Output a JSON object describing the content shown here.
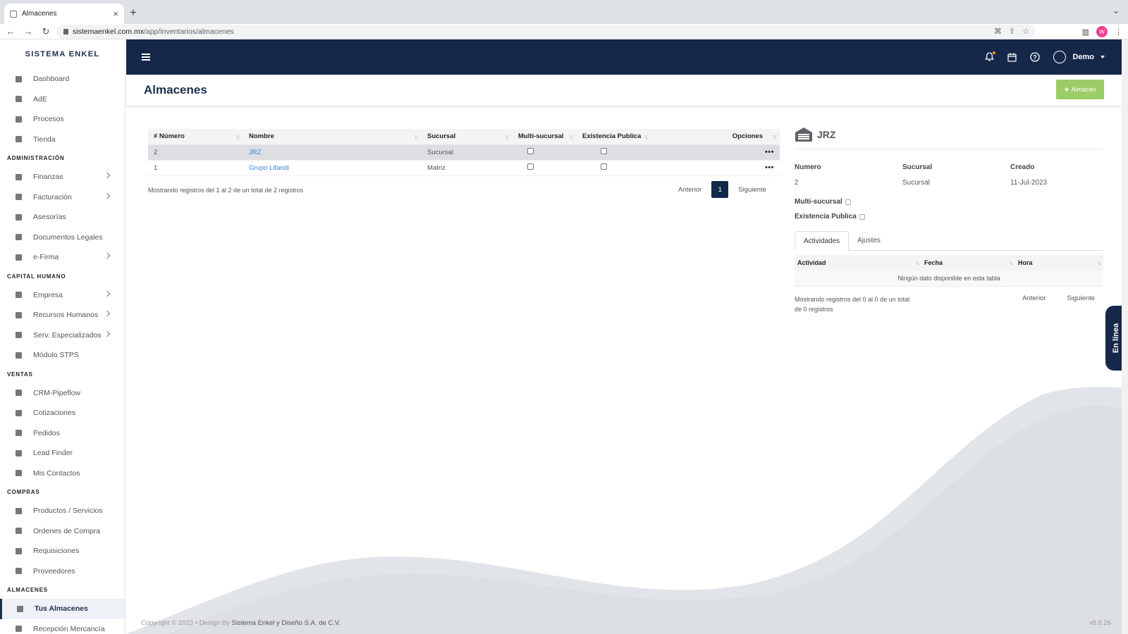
{
  "browser": {
    "tab_title": "Almacenes",
    "url_host": "sistemaenkel.com.mx",
    "url_path": "/app/inventarios/almacenes",
    "profile_initial": "W"
  },
  "sidebar": {
    "brand": "SISTEMA ENKEL",
    "items": [
      {
        "type": "item",
        "label": "Dashboard",
        "icon": "home-icon"
      },
      {
        "type": "item",
        "label": "AdE",
        "icon": "list-icon"
      },
      {
        "type": "item",
        "label": "Procesos",
        "icon": "share-icon"
      },
      {
        "type": "item",
        "label": "Tienda",
        "icon": "bag-icon"
      },
      {
        "type": "header",
        "label": "ADMINISTRACIÓN"
      },
      {
        "type": "item",
        "label": "Finanzas",
        "icon": "document-icon",
        "chevron": true
      },
      {
        "type": "item",
        "label": "Facturación",
        "icon": "document-icon",
        "chevron": true
      },
      {
        "type": "item",
        "label": "Asesorías",
        "icon": "eject-icon"
      },
      {
        "type": "item",
        "label": "Documentos Legales",
        "icon": "document-icon"
      },
      {
        "type": "item",
        "label": "e-Firma",
        "icon": "signature-icon",
        "chevron": true
      },
      {
        "type": "header",
        "label": "CAPITAL HUMANO"
      },
      {
        "type": "item",
        "label": "Empresa",
        "icon": "building-icon",
        "chevron": true
      },
      {
        "type": "item",
        "label": "Recursos Humanos",
        "icon": "users-icon",
        "chevron": true
      },
      {
        "type": "item",
        "label": "Serv. Especializados",
        "icon": "industry-icon",
        "chevron": true
      },
      {
        "type": "item",
        "label": "Módulo STPS",
        "icon": "document-icon"
      },
      {
        "type": "header",
        "label": "VENTAS"
      },
      {
        "type": "item",
        "label": "CRM-Pipeflow",
        "icon": "filter-icon"
      },
      {
        "type": "item",
        "label": "Cotizaciones",
        "icon": "document-icon"
      },
      {
        "type": "item",
        "label": "Pedidos",
        "icon": "card-icon"
      },
      {
        "type": "item",
        "label": "Lead Finder",
        "icon": "search-icon"
      },
      {
        "type": "item",
        "label": "Mis Contactos",
        "icon": "contact-icon"
      },
      {
        "type": "header",
        "label": "COMPRAS"
      },
      {
        "type": "item",
        "label": "Productos / Servicios",
        "icon": "box-icon"
      },
      {
        "type": "item",
        "label": "Ordenes de Compra",
        "icon": "card-icon"
      },
      {
        "type": "item",
        "label": "Requisiciones",
        "icon": "document-icon"
      },
      {
        "type": "item",
        "label": "Proveedores",
        "icon": "user-icon"
      },
      {
        "type": "header",
        "label": "ALMACENES"
      },
      {
        "type": "item",
        "label": "Tus Almacenes",
        "icon": "warehouse-icon",
        "active": true
      },
      {
        "type": "item",
        "label": "Recepción Mercancía",
        "icon": "sign-in-icon"
      }
    ]
  },
  "topbar": {
    "user": "Demo"
  },
  "page": {
    "title": "Almacenes",
    "add_button": "Almacen"
  },
  "table": {
    "columns": [
      "# Número",
      "Nombre",
      "Sucursal",
      "Multi-sucursal",
      "Existencia Publica",
      "Opciones"
    ],
    "rows": [
      {
        "numero": "2",
        "nombre": "JRZ",
        "sucursal": "Sucursal",
        "multi": false,
        "publica": false,
        "selected": true
      },
      {
        "numero": "1",
        "nombre": "Grupo Lifandi",
        "sucursal": "Matriz",
        "multi": false,
        "publica": false,
        "selected": false
      }
    ],
    "info": "Mostrando registros del 1 al 2 de un total de 2 registros",
    "prev": "Anterior",
    "page": "1",
    "next": "Siguiente"
  },
  "detail": {
    "title": "JRZ",
    "labels": {
      "numero": "Numero",
      "sucursal": "Sucursal",
      "creado": "Creado",
      "multi": "Multi-sucursal",
      "publica": "Existencia Publica"
    },
    "values": {
      "numero": "2",
      "sucursal": "Sucursal",
      "creado": "11-Jul-2023"
    },
    "tabs": [
      "Actividades",
      "Ajustes"
    ],
    "sub_columns": [
      "Actividad",
      "Fecha",
      "Hora"
    ],
    "empty": "Ningún dato disponible en esta tabla",
    "info": "Mostrando registros del 0 al 0 de un total de 0 registros",
    "prev": "Anterior",
    "next": "Siguiente"
  },
  "online_label": "En línea",
  "footer": {
    "copyright": "Copyright © 2023",
    "design": "Design By",
    "company": "Sistema Enkel y Diseño S.A. de C.V.",
    "version": "v8.6.26"
  },
  "colors": {
    "navy": "#15284a",
    "accent_green": "#9ccc65",
    "link": "#3b7dd8"
  }
}
